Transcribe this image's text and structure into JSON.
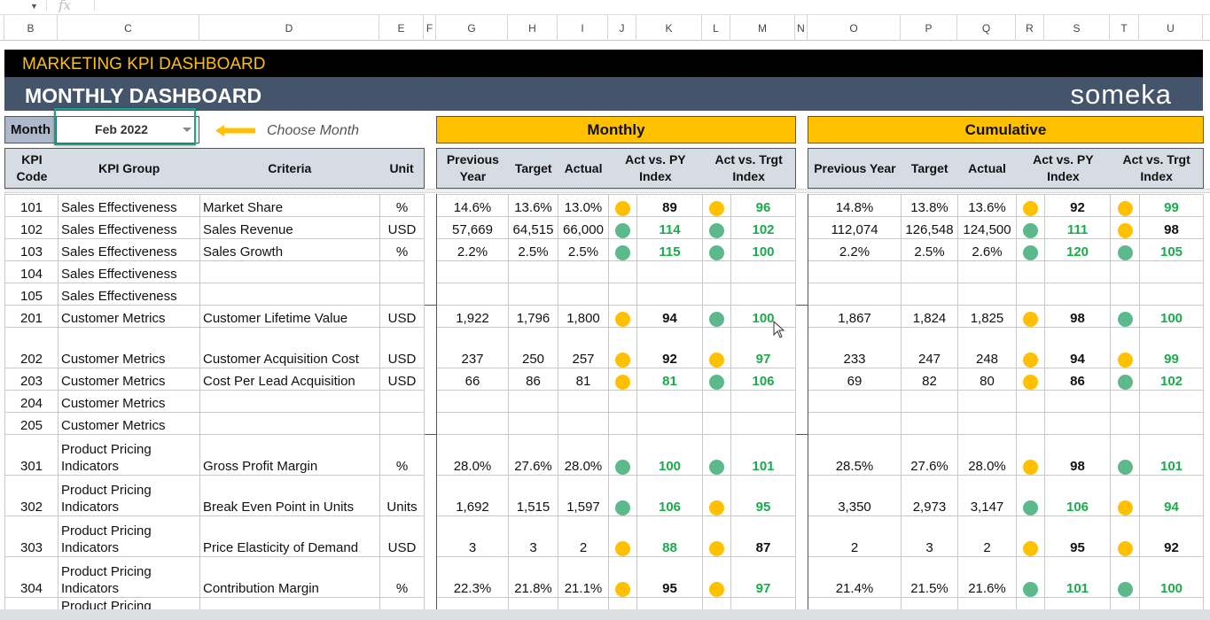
{
  "formula_bar": {
    "fx": "fx"
  },
  "columns": [
    "B",
    "C",
    "D",
    "E",
    "F",
    "G",
    "H",
    "I",
    "J",
    "K",
    "L",
    "M",
    "N",
    "O",
    "P",
    "Q",
    "R",
    "S",
    "T",
    "U"
  ],
  "title": "MARKETING KPI DASHBOARD",
  "subtitle": "MONTHLY DASHBOARD",
  "logo": "someka",
  "month": {
    "label": "Month",
    "value": "Feb 2022",
    "hint": "Choose Month"
  },
  "sections": {
    "monthly": "Monthly",
    "cumulative": "Cumulative"
  },
  "headers": {
    "code": "KPI Code",
    "group": "KPI Group",
    "criteria": "Criteria",
    "unit": "Unit",
    "py": "Previous Year",
    "target": "Target",
    "actual": "Actual",
    "py_idx": "Act vs. PY Index",
    "tg_idx": "Act vs. Trgt Index"
  },
  "colors": {
    "yellow": "#FFC000",
    "green": "#5BB98B",
    "green_text": "#1AAB4B",
    "black_text": "#111111",
    "header_bg": "#D6DCE4",
    "title_bg": "#44546A"
  },
  "rows": [
    {
      "code": "101",
      "group": "Sales Effectiveness",
      "criteria": "Market Share",
      "unit": "%",
      "m": {
        "py": "14.6%",
        "target": "13.6%",
        "actual": "13.0%",
        "py_idx": {
          "v": "89",
          "dot": "yellow",
          "color": "black"
        },
        "tg_idx": {
          "v": "96",
          "dot": "yellow",
          "color": "green"
        }
      },
      "c": {
        "py": "14.8%",
        "target": "13.8%",
        "actual": "13.6%",
        "py_idx": {
          "v": "92",
          "dot": "yellow",
          "color": "black"
        },
        "tg_idx": {
          "v": "99",
          "dot": "yellow",
          "color": "green"
        }
      }
    },
    {
      "code": "102",
      "group": "Sales Effectiveness",
      "criteria": "Sales Revenue",
      "unit": "USD",
      "m": {
        "py": "57,669",
        "target": "64,515",
        "actual": "66,000",
        "py_idx": {
          "v": "114",
          "dot": "green",
          "color": "green"
        },
        "tg_idx": {
          "v": "102",
          "dot": "green",
          "color": "green"
        }
      },
      "c": {
        "py": "112,074",
        "target": "126,548",
        "actual": "124,500",
        "py_idx": {
          "v": "111",
          "dot": "green",
          "color": "green"
        },
        "tg_idx": {
          "v": "98",
          "dot": "yellow",
          "color": "black"
        }
      }
    },
    {
      "code": "103",
      "group": "Sales Effectiveness",
      "criteria": "Sales Growth",
      "unit": "%",
      "m": {
        "py": "2.2%",
        "target": "2.5%",
        "actual": "2.5%",
        "py_idx": {
          "v": "115",
          "dot": "green",
          "color": "green"
        },
        "tg_idx": {
          "v": "100",
          "dot": "green",
          "color": "green"
        }
      },
      "c": {
        "py": "2.2%",
        "target": "2.5%",
        "actual": "2.6%",
        "py_idx": {
          "v": "120",
          "dot": "green",
          "color": "green"
        },
        "tg_idx": {
          "v": "105",
          "dot": "green",
          "color": "green"
        }
      }
    },
    {
      "code": "104",
      "group": "Sales Effectiveness",
      "criteria": "",
      "unit": ""
    },
    {
      "code": "105",
      "group": "Sales Effectiveness",
      "criteria": "",
      "unit": ""
    },
    {
      "code": "201",
      "group": "Customer Metrics",
      "criteria": "Customer Lifetime Value",
      "unit": "USD",
      "m": {
        "py": "1,922",
        "target": "1,796",
        "actual": "1,800",
        "py_idx": {
          "v": "94",
          "dot": "yellow",
          "color": "black"
        },
        "tg_idx": {
          "v": "100",
          "dot": "green",
          "color": "green"
        }
      },
      "c": {
        "py": "1,867",
        "target": "1,824",
        "actual": "1,825",
        "py_idx": {
          "v": "98",
          "dot": "yellow",
          "color": "black"
        },
        "tg_idx": {
          "v": "100",
          "dot": "green",
          "color": "green"
        }
      }
    },
    {
      "code": "202",
      "group": "Customer Metrics",
      "criteria": "Customer Acquisition Cost",
      "unit": "USD",
      "m": {
        "py": "237",
        "target": "250",
        "actual": "257",
        "py_idx": {
          "v": "92",
          "dot": "yellow",
          "color": "black"
        },
        "tg_idx": {
          "v": "97",
          "dot": "yellow",
          "color": "green"
        }
      },
      "c": {
        "py": "233",
        "target": "247",
        "actual": "248",
        "py_idx": {
          "v": "94",
          "dot": "yellow",
          "color": "black"
        },
        "tg_idx": {
          "v": "99",
          "dot": "yellow",
          "color": "green"
        }
      }
    },
    {
      "code": "203",
      "group": "Customer Metrics",
      "criteria": "Cost Per Lead Acquisition",
      "unit": "USD",
      "m": {
        "py": "66",
        "target": "86",
        "actual": "81",
        "py_idx": {
          "v": "81",
          "dot": "yellow",
          "color": "green"
        },
        "tg_idx": {
          "v": "106",
          "dot": "green",
          "color": "green"
        }
      },
      "c": {
        "py": "69",
        "target": "82",
        "actual": "80",
        "py_idx": {
          "v": "86",
          "dot": "yellow",
          "color": "black"
        },
        "tg_idx": {
          "v": "102",
          "dot": "green",
          "color": "green"
        }
      }
    },
    {
      "code": "204",
      "group": "Customer Metrics",
      "criteria": "",
      "unit": ""
    },
    {
      "code": "205",
      "group": "Customer Metrics",
      "criteria": "",
      "unit": ""
    },
    {
      "code": "301",
      "group": "Product Pricing Indicators",
      "criteria": "Gross Profit Margin",
      "unit": "%",
      "m": {
        "py": "28.0%",
        "target": "27.6%",
        "actual": "28.0%",
        "py_idx": {
          "v": "100",
          "dot": "green",
          "color": "green"
        },
        "tg_idx": {
          "v": "101",
          "dot": "green",
          "color": "green"
        }
      },
      "c": {
        "py": "28.5%",
        "target": "27.6%",
        "actual": "28.0%",
        "py_idx": {
          "v": "98",
          "dot": "yellow",
          "color": "black"
        },
        "tg_idx": {
          "v": "101",
          "dot": "green",
          "color": "green"
        }
      }
    },
    {
      "code": "302",
      "group": "Product Pricing Indicators",
      "criteria": "Break Even Point in Units",
      "unit": "Units",
      "m": {
        "py": "1,692",
        "target": "1,515",
        "actual": "1,597",
        "py_idx": {
          "v": "106",
          "dot": "green",
          "color": "green"
        },
        "tg_idx": {
          "v": "95",
          "dot": "yellow",
          "color": "green"
        }
      },
      "c": {
        "py": "3,350",
        "target": "2,973",
        "actual": "3,147",
        "py_idx": {
          "v": "106",
          "dot": "green",
          "color": "green"
        },
        "tg_idx": {
          "v": "94",
          "dot": "yellow",
          "color": "green"
        }
      }
    },
    {
      "code": "303",
      "group": "Product Pricing Indicators",
      "criteria": "Price Elasticity of Demand",
      "unit": "USD",
      "m": {
        "py": "3",
        "target": "3",
        "actual": "2",
        "py_idx": {
          "v": "88",
          "dot": "yellow",
          "color": "green"
        },
        "tg_idx": {
          "v": "87",
          "dot": "yellow",
          "color": "black"
        }
      },
      "c": {
        "py": "2",
        "target": "3",
        "actual": "2",
        "py_idx": {
          "v": "95",
          "dot": "yellow",
          "color": "black"
        },
        "tg_idx": {
          "v": "92",
          "dot": "yellow",
          "color": "black"
        }
      }
    },
    {
      "code": "304",
      "group": "Product Pricing Indicators",
      "criteria": "Contribution Margin",
      "unit": "%",
      "m": {
        "py": "22.3%",
        "target": "21.8%",
        "actual": "21.1%",
        "py_idx": {
          "v": "95",
          "dot": "yellow",
          "color": "black"
        },
        "tg_idx": {
          "v": "97",
          "dot": "yellow",
          "color": "green"
        }
      },
      "c": {
        "py": "21.4%",
        "target": "21.5%",
        "actual": "21.6%",
        "py_idx": {
          "v": "101",
          "dot": "green",
          "color": "green"
        },
        "tg_idx": {
          "v": "100",
          "dot": "green",
          "color": "green"
        }
      }
    },
    {
      "code": "",
      "group": "Product Pricing",
      "criteria": "",
      "unit": ""
    }
  ]
}
